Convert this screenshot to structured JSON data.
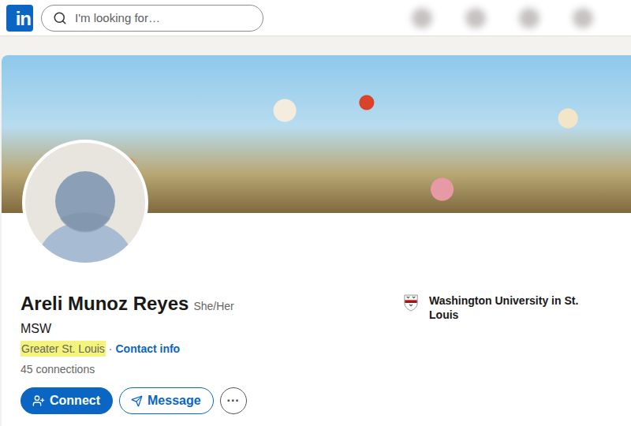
{
  "topbar": {
    "logo": "in",
    "search": {
      "placeholder": "I'm looking for…"
    }
  },
  "profile": {
    "name": "Areli Munoz Reyes",
    "pronouns": "She/Her",
    "headline": "MSW",
    "location": {
      "text": "Greater St. Louis",
      "highlighted": true
    },
    "separator": "·",
    "contact_link": "Contact info",
    "connections": "45 connections"
  },
  "education": {
    "school": "Washington University in St. Louis"
  },
  "actions": [
    {
      "label": "Connect",
      "kind": "primary"
    },
    {
      "label": "Message",
      "kind": "secondary"
    },
    {
      "label": "···",
      "kind": "more"
    }
  ]
}
